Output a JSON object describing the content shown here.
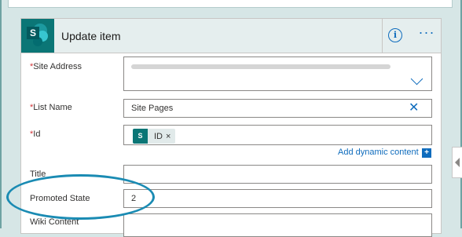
{
  "action": {
    "title": "Update item",
    "info_icon": "i",
    "more_icon": "···",
    "logo_letter": "S"
  },
  "fields": {
    "site_address": {
      "label": "Site Address",
      "required_mark": "*"
    },
    "list_name": {
      "label": "List Name",
      "required_mark": "*",
      "value": "Site Pages"
    },
    "id": {
      "label": "Id",
      "required_mark": "*",
      "token_label": "ID",
      "token_remove": "×",
      "token_logo": "S"
    },
    "title": {
      "label": "Title",
      "value": ""
    },
    "promoted_state": {
      "label": "Promoted State",
      "value": "2"
    },
    "wiki_content": {
      "label": "Wiki Content"
    }
  },
  "dynamic_content": {
    "link_label": "Add dynamic content",
    "plus_icon": "+"
  },
  "icons": {
    "clear": "✕",
    "sharepoint": "sharepoint-icon",
    "dropdown": "chevron-down-icon"
  },
  "colors": {
    "accent": "#0f6cbd",
    "header_bg": "#e5eeee",
    "sharepoint_teal": "#0b7676",
    "highlight_ellipse": "#1a8bb3"
  }
}
